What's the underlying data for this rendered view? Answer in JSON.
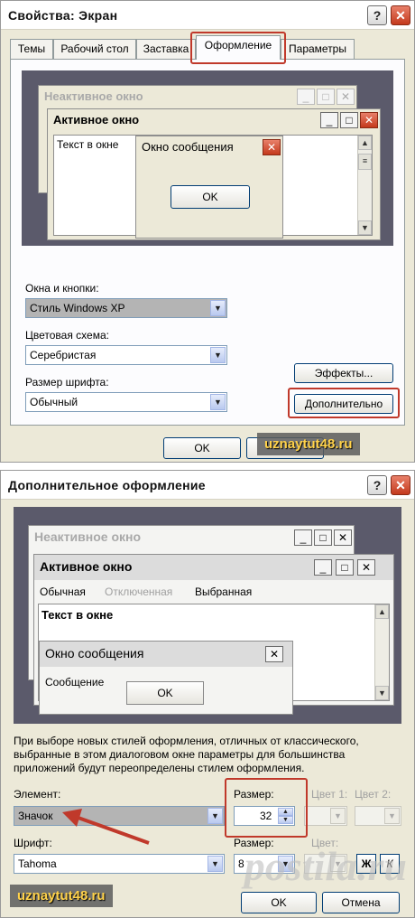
{
  "dialog1": {
    "title": "Свойства: Экран",
    "tabs": [
      "Темы",
      "Рабочий стол",
      "Заставка",
      "Оформление",
      "Параметры"
    ],
    "preview": {
      "inactive_title": "Неактивное окно",
      "active_title": "Активное окно",
      "window_text": "Текст в окне",
      "msg_title": "Окно сообщения",
      "ok": "OK"
    },
    "windows_buttons_label": "Окна и кнопки:",
    "windows_buttons_value": "Стиль Windows XP",
    "scheme_label": "Цветовая схема:",
    "scheme_value": "Серебристая",
    "font_size_label": "Размер шрифта:",
    "font_size_value": "Обычный",
    "effects_button": "Эффекты...",
    "advanced_button": "Дополнительно",
    "ok": "OK",
    "watermark": "uznaytut48.ru"
  },
  "dialog2": {
    "title": "Дополнительное оформление",
    "preview": {
      "inactive_title": "Неактивное окно",
      "active_title": "Активное окно",
      "menu_normal": "Обычная",
      "menu_disabled": "Отключенная",
      "menu_selected": "Выбранная",
      "window_text": "Текст в окне",
      "msg_title": "Окно сообщения",
      "msg_text": "Сообщение",
      "ok": "OK"
    },
    "info_text": "При выборе новых стилей оформления, отличных от классического, выбранные в этом диалоговом окне параметры для большинства приложений будут переопределены стилем оформления.",
    "element_label": "Элемент:",
    "element_value": "Значок",
    "size_label": "Размер:",
    "size_value": "32",
    "color1_label": "Цвет 1:",
    "color2_label": "Цвет 2:",
    "font_label": "Шрифт:",
    "font_value": "Tahoma",
    "font_size_label": "Размер:",
    "font_size_value": "8",
    "color_label": "Цвет:",
    "bold_label": "Ж",
    "italic_label": "К",
    "ok": "OK",
    "cancel": "Отмена",
    "watermark": "uznaytut48.ru",
    "posti": "postila.ru"
  },
  "colors": {
    "dialog_bg": "#ece9d8",
    "preview_bg": "#5b5a6b",
    "highlight": "#c0392b",
    "close_button": "#c4391c",
    "selected_combo": "#b4b4b4"
  }
}
